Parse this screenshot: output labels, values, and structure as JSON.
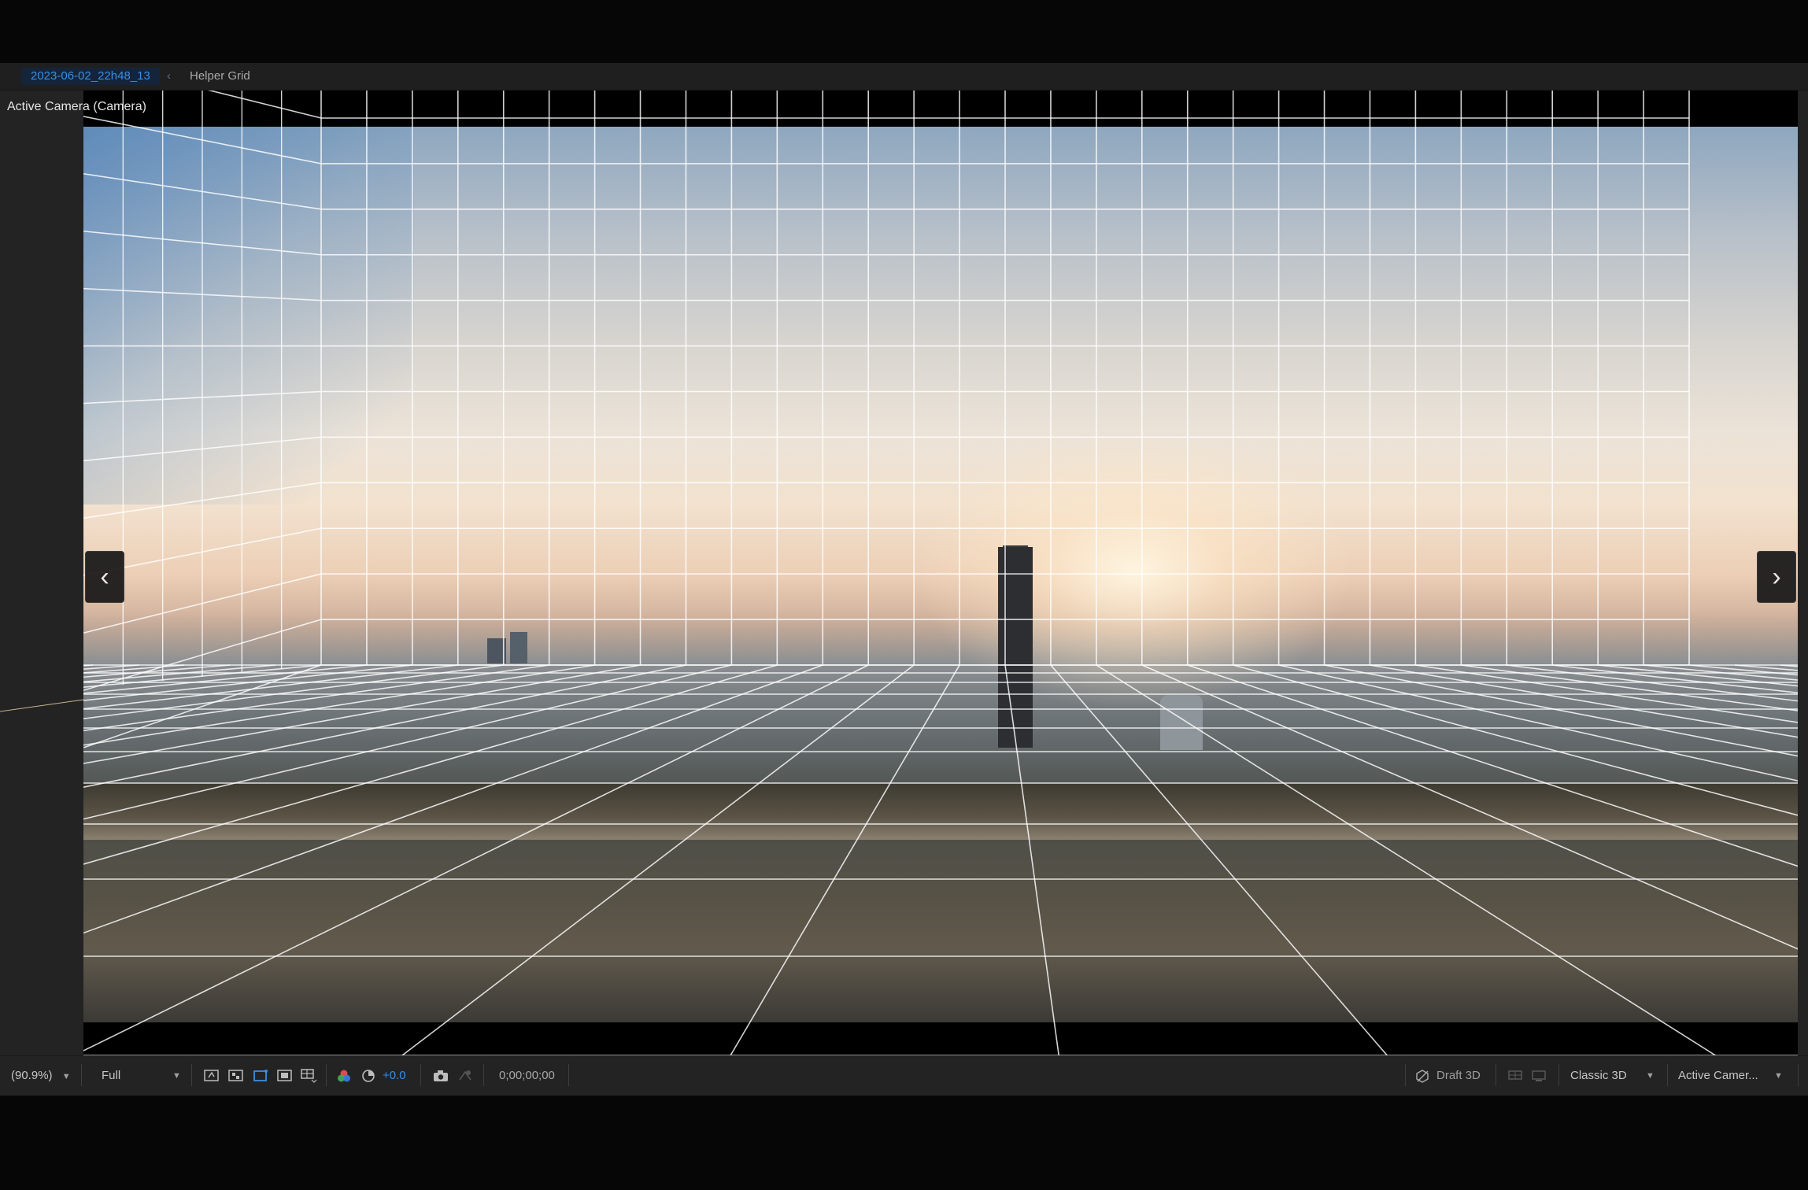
{
  "breadcrumb": {
    "active": "2023-06-02_22h48_13",
    "separator": "‹",
    "next": "Helper Grid"
  },
  "viewer": {
    "camera_label": "Active Camera (Camera)",
    "prev_arrow": "‹",
    "next_arrow": "›"
  },
  "toolbar": {
    "zoom": "(90.9%)",
    "resolution": "Full",
    "exposure": "+0.0",
    "timecode": "0;00;00;00",
    "draft3d": "Draft 3D",
    "renderer": "Classic 3D",
    "view": "Active Camer...",
    "accent_color": "#3a8ee6"
  },
  "icons": {
    "toolbar": [
      "fast-previews-icon",
      "transparency-grid-icon",
      "mask-path-icon",
      "region-of-interest-icon",
      "grid-guides-icon",
      "color-channel-icon",
      "reset-exposure-icon",
      "snapshot-icon",
      "show-snapshot-icon",
      "draft-3d-icon",
      "3d-ground-plane-icon",
      "extended-viewer-icon"
    ]
  }
}
